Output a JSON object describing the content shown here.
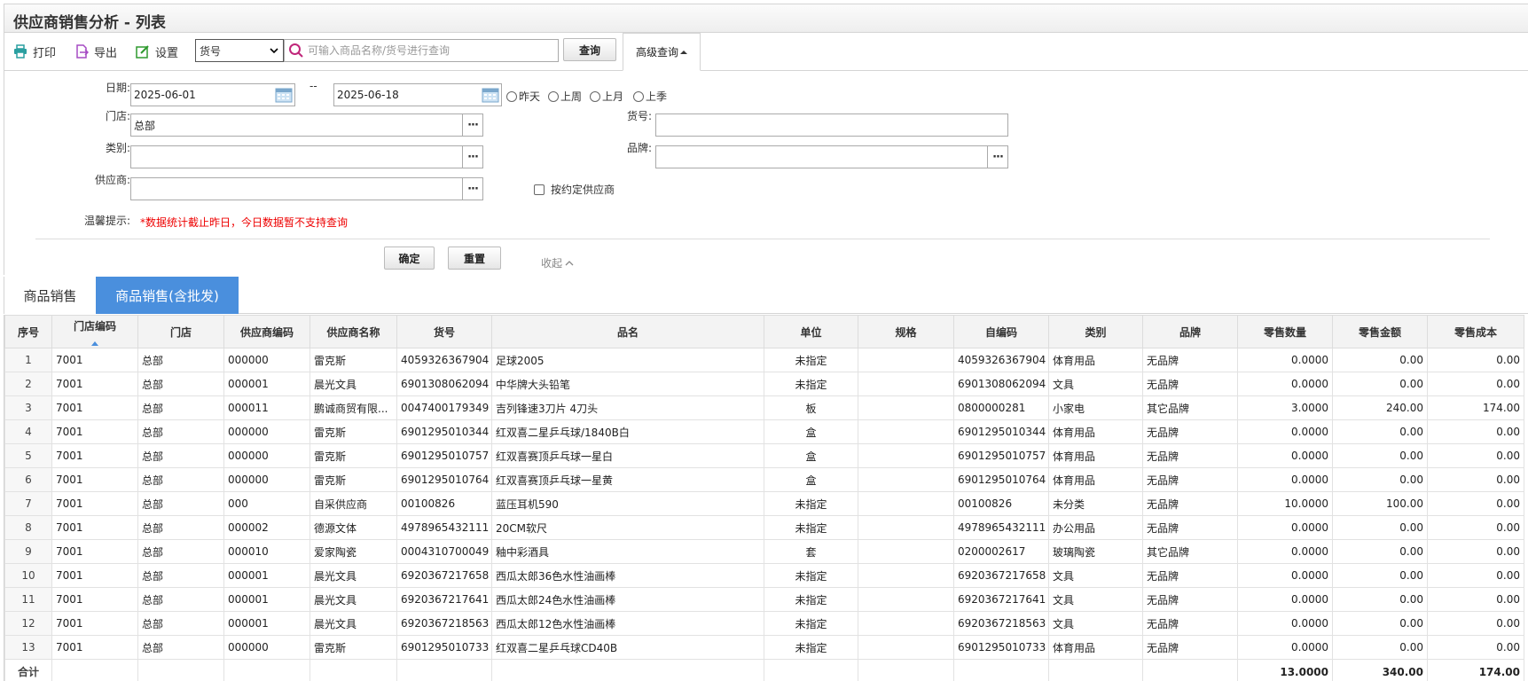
{
  "page": {
    "title": "供应商销售分析 - 列表"
  },
  "toolbar": {
    "print_label": "打印",
    "export_label": "导出",
    "settings_label": "设置",
    "search_field_selected": "货号",
    "search_placeholder": "可输入商品名称/货号进行查询",
    "query_label": "查询",
    "advanced_label": "高级查询"
  },
  "filters": {
    "date_label": "日期:",
    "date_from": "2025-06-01",
    "date_sep": "--",
    "date_to": "2025-06-18",
    "quick": [
      "昨天",
      "上周",
      "上月",
      "上季"
    ],
    "store_label": "门店:",
    "store_value": "总部",
    "sku_label": "货号:",
    "sku_value": "",
    "category_label": "类别:",
    "category_value": "",
    "brand_label": "品牌:",
    "brand_value": "",
    "supplier_label": "供应商:",
    "supplier_value": "",
    "contract_supplier_label": "按约定供应商",
    "tip_label": "温馨提示:",
    "tip_text": "*数据统计截止昨日，今日数据暂不支持查询",
    "confirm_label": "确定",
    "reset_label": "重置",
    "collapse_label": "收起"
  },
  "tabs": [
    {
      "label": "商品销售",
      "active": false
    },
    {
      "label": "商品销售(含批发)",
      "active": true
    }
  ],
  "table": {
    "columns": [
      "序号",
      "门店编码",
      "门店",
      "供应商编码",
      "供应商名称",
      "货号",
      "品名",
      "单位",
      "规格",
      "自编码",
      "类别",
      "品牌",
      "零售数量",
      "零售金额",
      "零售成本"
    ],
    "rows": [
      [
        "1",
        "7001",
        "总部",
        "000000",
        "雷克斯",
        "4059326367904",
        "足球2005",
        "未指定",
        "",
        "4059326367904",
        "体育用品",
        "无品牌",
        "0.0000",
        "0.00",
        "0.00"
      ],
      [
        "2",
        "7001",
        "总部",
        "000001",
        "晨光文具",
        "6901308062094",
        "中华牌大头铅笔",
        "未指定",
        "",
        "6901308062094",
        "文具",
        "无品牌",
        "0.0000",
        "0.00",
        "0.00"
      ],
      [
        "3",
        "7001",
        "总部",
        "000011",
        "鹏诚商贸有限...",
        "0047400179349",
        "吉列锋速3刀片 4刀头",
        "板",
        "",
        "0800000281",
        "小家电",
        "其它品牌",
        "3.0000",
        "240.00",
        "174.00"
      ],
      [
        "4",
        "7001",
        "总部",
        "000000",
        "雷克斯",
        "6901295010344",
        "红双喜二星乒乓球/1840B白",
        "盒",
        "",
        "6901295010344",
        "体育用品",
        "无品牌",
        "0.0000",
        "0.00",
        "0.00"
      ],
      [
        "5",
        "7001",
        "总部",
        "000000",
        "雷克斯",
        "6901295010757",
        "红双喜赛顶乒乓球一星白",
        "盒",
        "",
        "6901295010757",
        "体育用品",
        "无品牌",
        "0.0000",
        "0.00",
        "0.00"
      ],
      [
        "6",
        "7001",
        "总部",
        "000000",
        "雷克斯",
        "6901295010764",
        "红双喜赛顶乒乓球一星黄",
        "盒",
        "",
        "6901295010764",
        "体育用品",
        "无品牌",
        "0.0000",
        "0.00",
        "0.00"
      ],
      [
        "7",
        "7001",
        "总部",
        "000",
        "自采供应商",
        "00100826",
        "蓝压耳机590",
        "未指定",
        "",
        "00100826",
        "未分类",
        "无品牌",
        "10.0000",
        "100.00",
        "0.00"
      ],
      [
        "8",
        "7001",
        "总部",
        "000002",
        "德源文体",
        "4978965432111",
        "20CM软尺",
        "未指定",
        "",
        "4978965432111",
        "办公用品",
        "无品牌",
        "0.0000",
        "0.00",
        "0.00"
      ],
      [
        "9",
        "7001",
        "总部",
        "000010",
        "爱家陶瓷",
        "0004310700049",
        "釉中彩酒具",
        "套",
        "",
        "0200002617",
        "玻璃陶瓷",
        "其它品牌",
        "0.0000",
        "0.00",
        "0.00"
      ],
      [
        "10",
        "7001",
        "总部",
        "000001",
        "晨光文具",
        "6920367217658",
        "西瓜太郎36色水性油画棒",
        "未指定",
        "",
        "6920367217658",
        "文具",
        "无品牌",
        "0.0000",
        "0.00",
        "0.00"
      ],
      [
        "11",
        "7001",
        "总部",
        "000001",
        "晨光文具",
        "6920367217641",
        "西瓜太郎24色水性油画棒",
        "未指定",
        "",
        "6920367217641",
        "文具",
        "无品牌",
        "0.0000",
        "0.00",
        "0.00"
      ],
      [
        "12",
        "7001",
        "总部",
        "000001",
        "晨光文具",
        "6920367218563",
        "西瓜太郎12色水性油画棒",
        "未指定",
        "",
        "6920367218563",
        "文具",
        "无品牌",
        "0.0000",
        "0.00",
        "0.00"
      ],
      [
        "13",
        "7001",
        "总部",
        "000000",
        "雷克斯",
        "6901295010733",
        "红双喜二星乒乓球CD40B",
        "未指定",
        "",
        "6901295010733",
        "体育用品",
        "无品牌",
        "0.0000",
        "0.00",
        "0.00"
      ]
    ],
    "total": {
      "label": "合计",
      "qty": "13.0000",
      "amount": "340.00",
      "cost": "174.00"
    }
  },
  "colors": {
    "accent": "#4a8fdd",
    "tip_red": "#ee0000",
    "icon_teal": "#2a9fa0",
    "icon_purple": "#a64bc4",
    "icon_green": "#2f9a2f"
  }
}
